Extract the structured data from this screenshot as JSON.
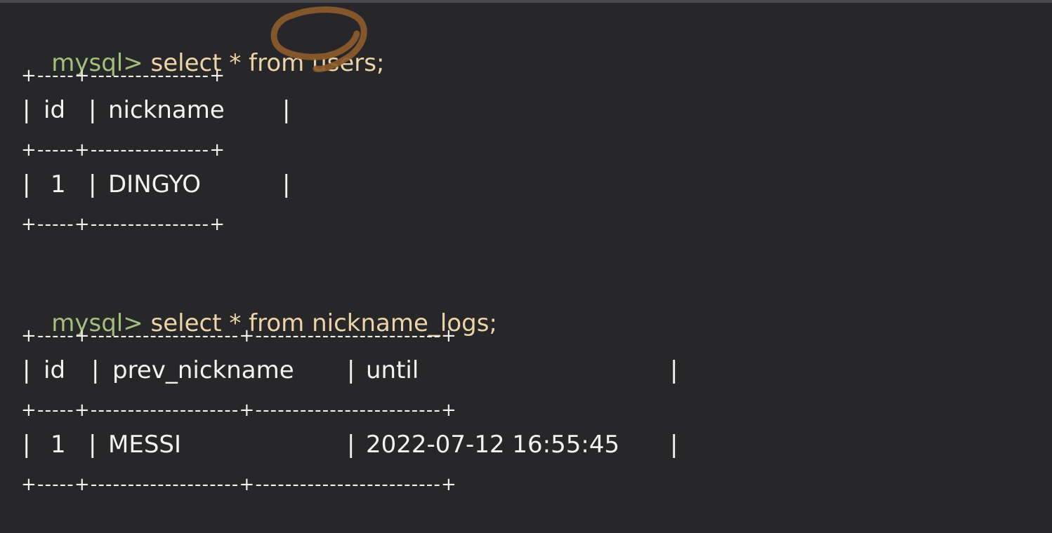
{
  "terminal": {
    "query1": {
      "prompt": "mysql>",
      "command": "select * from users;"
    },
    "table1": {
      "border": "+-----+----------------+",
      "headers": [
        "id",
        "nickname"
      ],
      "rows": [
        [
          "1",
          "DINGYO"
        ]
      ]
    },
    "query2": {
      "prompt": "mysql>",
      "command": "select * from nickname_logs;"
    },
    "table2": {
      "border": "+-----+--------------------+-------------------------+",
      "headers": [
        "id",
        "prev_nickname",
        "until"
      ],
      "rows": [
        [
          "1",
          "MESSI",
          "2022-07-12 16:55:45"
        ]
      ]
    }
  },
  "colors": {
    "background": "#272628",
    "prompt": "#a3bf7e",
    "command": "#ecd4a8",
    "text": "#f3f2f0",
    "annotation": "#8b5a2b"
  },
  "annotation": {
    "icon": "circle-highlight-annotation"
  }
}
